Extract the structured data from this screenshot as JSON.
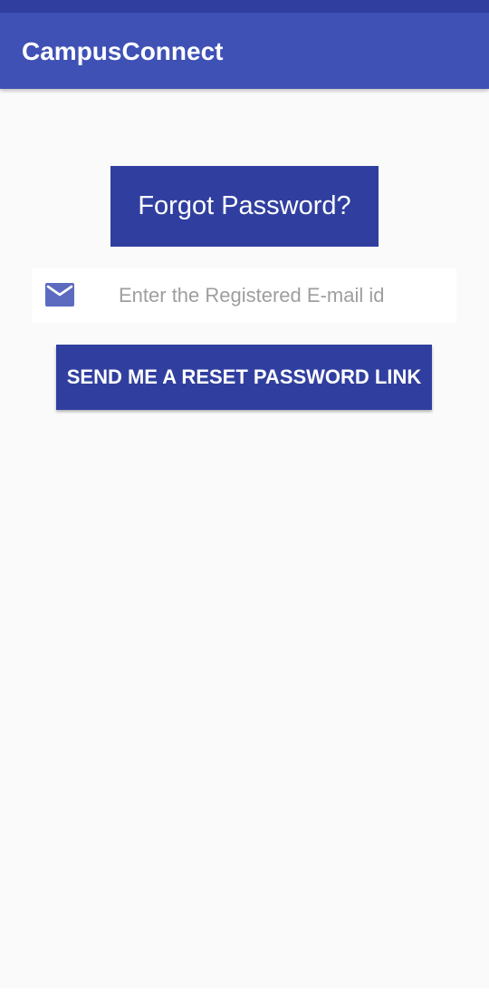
{
  "app_bar": {
    "title": "CampusConnect"
  },
  "main": {
    "heading": "Forgot Password?",
    "email_field": {
      "icon": "mail-icon",
      "placeholder": "Enter the Registered E-mail id",
      "value": ""
    },
    "reset_button_label": "SEND ME A RESET PASSWORD LINK"
  },
  "colors": {
    "status_bar": "#303f9f",
    "app_bar": "#3f51b5",
    "primary_dark": "#303f9f",
    "icon": "#5c6bc0",
    "background": "#fafafa"
  }
}
